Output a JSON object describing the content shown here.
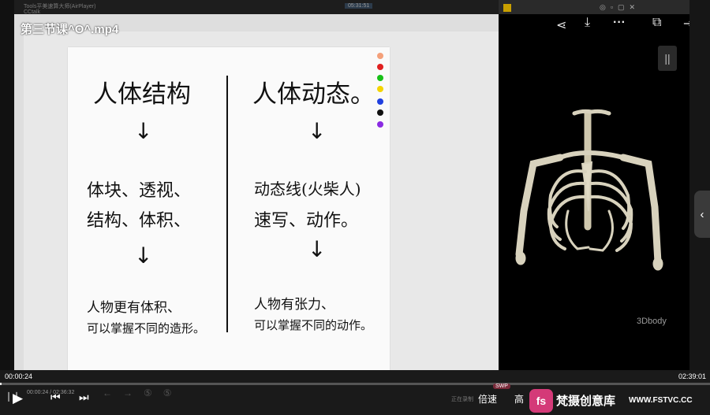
{
  "top_title": "第三节课^O^.mp4",
  "ghost_texts": {
    "window_title": "Tools平美速算大师(AirPlayer)",
    "app_name": "CCtalk",
    "timer": "05:31:51"
  },
  "whiteboard": {
    "left": {
      "heading": "人体结构",
      "line1": "体块、透视、",
      "line2": "结构、体积、",
      "note1": "人物更有体积、",
      "note2": "可以掌握不同的造形。"
    },
    "right": {
      "heading": "人体动态。",
      "line1": "动态线(火柴人)",
      "line2": "速写、动作。",
      "note1": "人物有张力、",
      "note2": "可以掌握不同的动作。"
    },
    "arrow": "↓",
    "palette": [
      "#f4a07a",
      "#e02020",
      "#18c018",
      "#f4d400",
      "#2040e0",
      "#111111",
      "#8a2be2"
    ]
  },
  "viewer": {
    "watermark": "3Dbody",
    "pause_icon": "||"
  },
  "player": {
    "current_time": "00:00:24",
    "total_time": "02:39:01",
    "progress": 0.0025,
    "small_time": "00:00:24 / 02:36:32",
    "speed_label": "倍速",
    "speed_badge": "SWP",
    "quality_label": "高",
    "recording_label": "正在录制"
  },
  "branding": {
    "logo_text": "fs",
    "name": "梵摄创意库",
    "url": "WWW.FSTVC.CC"
  }
}
